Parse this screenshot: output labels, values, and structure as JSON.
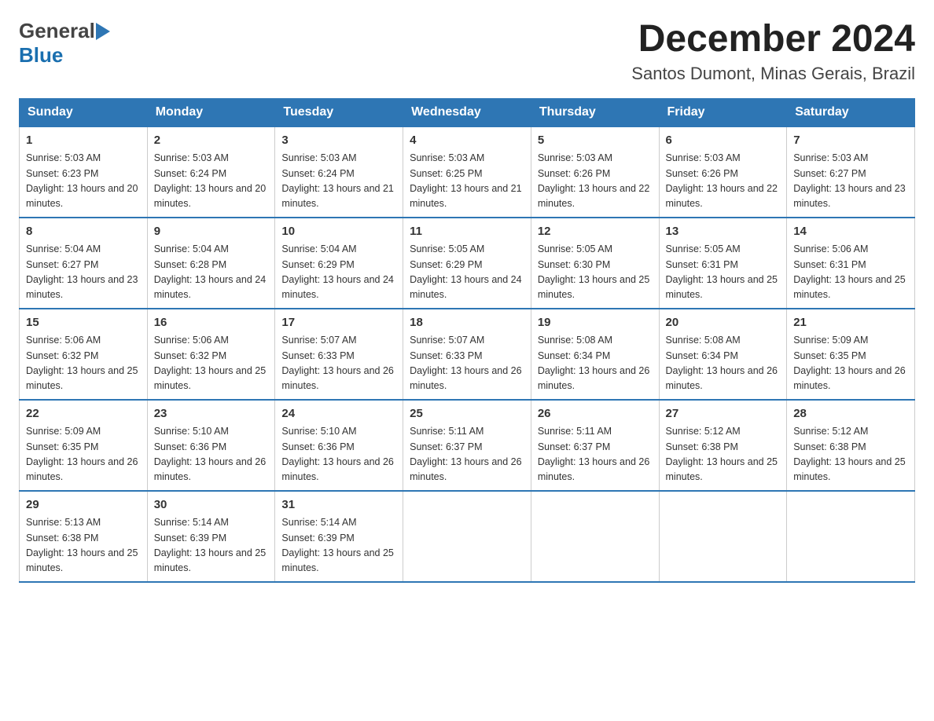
{
  "logo": {
    "general": "General",
    "blue": "Blue",
    "triangle": "▶"
  },
  "title": "December 2024",
  "subtitle": "Santos Dumont, Minas Gerais, Brazil",
  "weekdays": [
    "Sunday",
    "Monday",
    "Tuesday",
    "Wednesday",
    "Thursday",
    "Friday",
    "Saturday"
  ],
  "weeks": [
    [
      {
        "day": "1",
        "sunrise": "5:03 AM",
        "sunset": "6:23 PM",
        "daylight": "13 hours and 20 minutes."
      },
      {
        "day": "2",
        "sunrise": "5:03 AM",
        "sunset": "6:24 PM",
        "daylight": "13 hours and 20 minutes."
      },
      {
        "day": "3",
        "sunrise": "5:03 AM",
        "sunset": "6:24 PM",
        "daylight": "13 hours and 21 minutes."
      },
      {
        "day": "4",
        "sunrise": "5:03 AM",
        "sunset": "6:25 PM",
        "daylight": "13 hours and 21 minutes."
      },
      {
        "day": "5",
        "sunrise": "5:03 AM",
        "sunset": "6:26 PM",
        "daylight": "13 hours and 22 minutes."
      },
      {
        "day": "6",
        "sunrise": "5:03 AM",
        "sunset": "6:26 PM",
        "daylight": "13 hours and 22 minutes."
      },
      {
        "day": "7",
        "sunrise": "5:03 AM",
        "sunset": "6:27 PM",
        "daylight": "13 hours and 23 minutes."
      }
    ],
    [
      {
        "day": "8",
        "sunrise": "5:04 AM",
        "sunset": "6:27 PM",
        "daylight": "13 hours and 23 minutes."
      },
      {
        "day": "9",
        "sunrise": "5:04 AM",
        "sunset": "6:28 PM",
        "daylight": "13 hours and 24 minutes."
      },
      {
        "day": "10",
        "sunrise": "5:04 AM",
        "sunset": "6:29 PM",
        "daylight": "13 hours and 24 minutes."
      },
      {
        "day": "11",
        "sunrise": "5:05 AM",
        "sunset": "6:29 PM",
        "daylight": "13 hours and 24 minutes."
      },
      {
        "day": "12",
        "sunrise": "5:05 AM",
        "sunset": "6:30 PM",
        "daylight": "13 hours and 25 minutes."
      },
      {
        "day": "13",
        "sunrise": "5:05 AM",
        "sunset": "6:31 PM",
        "daylight": "13 hours and 25 minutes."
      },
      {
        "day": "14",
        "sunrise": "5:06 AM",
        "sunset": "6:31 PM",
        "daylight": "13 hours and 25 minutes."
      }
    ],
    [
      {
        "day": "15",
        "sunrise": "5:06 AM",
        "sunset": "6:32 PM",
        "daylight": "13 hours and 25 minutes."
      },
      {
        "day": "16",
        "sunrise": "5:06 AM",
        "sunset": "6:32 PM",
        "daylight": "13 hours and 25 minutes."
      },
      {
        "day": "17",
        "sunrise": "5:07 AM",
        "sunset": "6:33 PM",
        "daylight": "13 hours and 26 minutes."
      },
      {
        "day": "18",
        "sunrise": "5:07 AM",
        "sunset": "6:33 PM",
        "daylight": "13 hours and 26 minutes."
      },
      {
        "day": "19",
        "sunrise": "5:08 AM",
        "sunset": "6:34 PM",
        "daylight": "13 hours and 26 minutes."
      },
      {
        "day": "20",
        "sunrise": "5:08 AM",
        "sunset": "6:34 PM",
        "daylight": "13 hours and 26 minutes."
      },
      {
        "day": "21",
        "sunrise": "5:09 AM",
        "sunset": "6:35 PM",
        "daylight": "13 hours and 26 minutes."
      }
    ],
    [
      {
        "day": "22",
        "sunrise": "5:09 AM",
        "sunset": "6:35 PM",
        "daylight": "13 hours and 26 minutes."
      },
      {
        "day": "23",
        "sunrise": "5:10 AM",
        "sunset": "6:36 PM",
        "daylight": "13 hours and 26 minutes."
      },
      {
        "day": "24",
        "sunrise": "5:10 AM",
        "sunset": "6:36 PM",
        "daylight": "13 hours and 26 minutes."
      },
      {
        "day": "25",
        "sunrise": "5:11 AM",
        "sunset": "6:37 PM",
        "daylight": "13 hours and 26 minutes."
      },
      {
        "day": "26",
        "sunrise": "5:11 AM",
        "sunset": "6:37 PM",
        "daylight": "13 hours and 26 minutes."
      },
      {
        "day": "27",
        "sunrise": "5:12 AM",
        "sunset": "6:38 PM",
        "daylight": "13 hours and 25 minutes."
      },
      {
        "day": "28",
        "sunrise": "5:12 AM",
        "sunset": "6:38 PM",
        "daylight": "13 hours and 25 minutes."
      }
    ],
    [
      {
        "day": "29",
        "sunrise": "5:13 AM",
        "sunset": "6:38 PM",
        "daylight": "13 hours and 25 minutes."
      },
      {
        "day": "30",
        "sunrise": "5:14 AM",
        "sunset": "6:39 PM",
        "daylight": "13 hours and 25 minutes."
      },
      {
        "day": "31",
        "sunrise": "5:14 AM",
        "sunset": "6:39 PM",
        "daylight": "13 hours and 25 minutes."
      },
      null,
      null,
      null,
      null
    ]
  ],
  "labels": {
    "sunrise": "Sunrise:",
    "sunset": "Sunset:",
    "daylight": "Daylight:"
  }
}
